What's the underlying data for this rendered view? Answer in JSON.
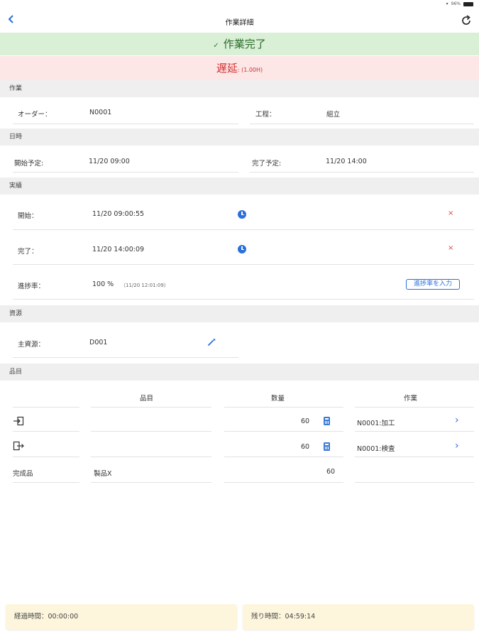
{
  "status_bar": {
    "battery": "96%"
  },
  "nav": {
    "title": "作業詳細"
  },
  "banners": {
    "done": "作業完了",
    "delay": "遅延",
    "delay_sub": ": (1.00H)"
  },
  "sections": {
    "work": "作業",
    "datetime": "日時",
    "actual": "実績",
    "resource": "資源",
    "items": "品目"
  },
  "work": {
    "order_label": "オーダー：",
    "order_value": "N0001",
    "process_label": "工程：",
    "process_value": "組立"
  },
  "datetime": {
    "start_label": "開始予定:",
    "start_value": "11/20 09:00",
    "end_label": "完了予定:",
    "end_value": "11/20 14:00"
  },
  "actual": {
    "start_label": "開始：",
    "start_value": "11/20 09:00:55",
    "end_label": "完了：",
    "end_value": "11/20 14:00:09",
    "progress_label": "進捗率：",
    "progress_value": "100 %",
    "progress_time": "（11/20 12:01:09）",
    "progress_button": "進捗率を入力"
  },
  "resource": {
    "main_label": "主資源：",
    "main_value": "D001"
  },
  "items_table": {
    "headers": {
      "item": "品目",
      "qty": "数量",
      "work": "作業"
    },
    "rows": [
      {
        "type": "input",
        "item": "",
        "qty": "60",
        "work": "N0001:加工"
      },
      {
        "type": "output",
        "item": "",
        "qty": "60",
        "work": "N0001:検査"
      },
      {
        "type": "完成品",
        "item": "製品X",
        "qty": "60",
        "work": ""
      }
    ]
  },
  "footer": {
    "elapsed": "経過時間：00:00:00",
    "remaining": "残り時間：04:59:14"
  }
}
